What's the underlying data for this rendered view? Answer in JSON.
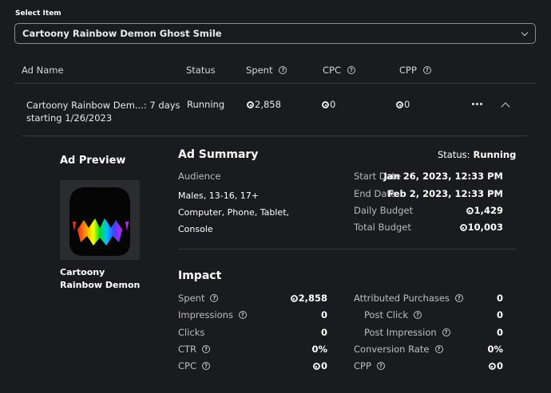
{
  "select": {
    "label": "Select Item",
    "value": "Cartoony Rainbow Demon Ghost Smile"
  },
  "table": {
    "headers": {
      "ad_name": "Ad Name",
      "status": "Status",
      "spent": "Spent",
      "cpc": "CPC",
      "cpp": "CPP"
    },
    "row": {
      "ad_name_line1": "Cartoony Rainbow Dem...: 7 days",
      "ad_name_line2": "starting 1/26/2023",
      "status": "Running",
      "spent": "2,858",
      "cpc": "0",
      "cpp": "0"
    }
  },
  "preview": {
    "title": "Ad Preview",
    "item_name_line1": "Cartoony",
    "item_name_line2": "Rainbow Demon"
  },
  "summary": {
    "title": "Ad Summary",
    "status_label": "Status:",
    "status_value": "Running",
    "audience_label": "Audience",
    "audience_line1": "Males, 13-16, 17+",
    "audience_line2": "Computer, Phone, Tablet,",
    "audience_line3": "Console",
    "start_date_label": "Start Date",
    "start_date_value": "Jan 26, 2023, 12:33 PM",
    "end_date_label": "End Date",
    "end_date_value": "Feb 2, 2023, 12:33 PM",
    "daily_budget_label": "Daily Budget",
    "daily_budget_value": "1,429",
    "total_budget_label": "Total Budget",
    "total_budget_value": "10,003"
  },
  "impact": {
    "title": "Impact",
    "left": [
      {
        "label": "Spent",
        "value": "2,858",
        "robux": true
      },
      {
        "label": "Impressions",
        "value": "0",
        "robux": false
      },
      {
        "label": "Clicks",
        "value": "0",
        "robux": false
      },
      {
        "label": "CTR",
        "value": "0%",
        "robux": false
      },
      {
        "label": "CPC",
        "value": "0",
        "robux": true
      }
    ],
    "right": [
      {
        "label": "Attributed Purchases",
        "value": "0",
        "robux": false
      },
      {
        "label": "Post Click",
        "value": "0",
        "robux": false
      },
      {
        "label": "Post Impression",
        "value": "0",
        "robux": false
      },
      {
        "label": "Conversion Rate",
        "value": "0%",
        "robux": false
      },
      {
        "label": "CPP",
        "value": "0",
        "robux": true
      }
    ]
  },
  "colors": {
    "background": "#1a1b1e",
    "divider": "#3a3b3e",
    "text": "#e8e9ea"
  }
}
